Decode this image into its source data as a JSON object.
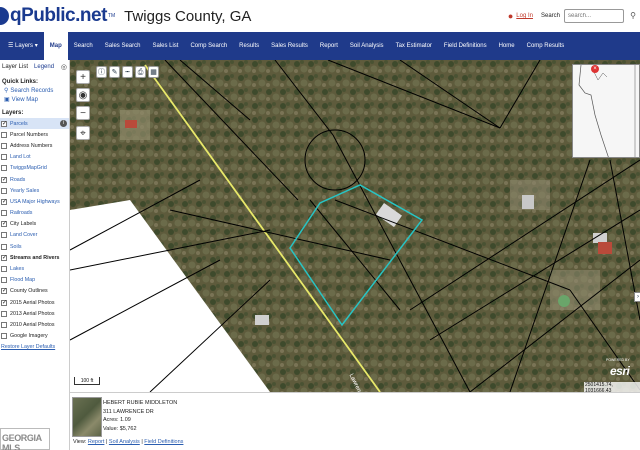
{
  "header": {
    "logo_text": "qPublic.net",
    "logo_tm": "TM",
    "county": "Twiggs County, GA",
    "login": "Log In",
    "search_label": "Search",
    "search_placeholder": "search..."
  },
  "nav": {
    "layers": "Layers",
    "items": [
      "Map",
      "Search",
      "Sales Search",
      "Sales List",
      "Comp Search",
      "Results",
      "Sales Results",
      "Report",
      "Soil Analysis",
      "Tax Estimator",
      "Field Definitions",
      "Home",
      "Comp Results"
    ]
  },
  "sidebar": {
    "tabs": [
      "Layer List",
      "Legend"
    ],
    "quick_links_heading": "Quick Links:",
    "quick_links": [
      "Search Records",
      "View Map"
    ],
    "layers_heading": "Layers:",
    "layers": [
      {
        "label": "Parcels",
        "checked": true,
        "style": "blue"
      },
      {
        "label": "Parcel Numbers",
        "checked": false,
        "style": ""
      },
      {
        "label": "Address Numbers",
        "checked": false,
        "style": ""
      },
      {
        "label": "Land Lot",
        "checked": false,
        "style": "blue"
      },
      {
        "label": "TwiggsMapGrid",
        "checked": false,
        "style": "blue"
      },
      {
        "label": "Roads",
        "checked": true,
        "style": "blue"
      },
      {
        "label": "Yearly Sales",
        "checked": false,
        "style": "blue"
      },
      {
        "label": "USA Major Highways",
        "checked": true,
        "style": "blue"
      },
      {
        "label": "Railroads",
        "checked": false,
        "style": "blue"
      },
      {
        "label": "City Labels",
        "checked": true,
        "style": ""
      },
      {
        "label": "Land Cover",
        "checked": false,
        "style": "blue"
      },
      {
        "label": "Soils",
        "checked": false,
        "style": "blue"
      },
      {
        "label": "Streams and Rivers",
        "checked": true,
        "style": "bold"
      },
      {
        "label": "Lakes",
        "checked": false,
        "style": "blue"
      },
      {
        "label": "Flood Map",
        "checked": false,
        "style": "blue"
      },
      {
        "label": "County Outlines",
        "checked": true,
        "style": ""
      },
      {
        "label": "2015 Aerial Photos",
        "checked": true,
        "style": ""
      },
      {
        "label": "2013 Aerial Photos",
        "checked": false,
        "style": ""
      },
      {
        "label": "2010 Aerial Photos",
        "checked": false,
        "style": ""
      },
      {
        "label": "Google Imagery",
        "checked": false,
        "style": ""
      }
    ],
    "restore": "Restore Layer Defaults"
  },
  "map": {
    "zoom_in": "+",
    "zoom_out": "−",
    "scale": "100 ft",
    "powered_by": "POWERED BY",
    "esri": "esri",
    "coords": "2501415.74, 1031666.43",
    "road_label": "Lawrence Dr",
    "colors": {
      "parcel_line": "#000000",
      "selected_parcel": "#27c4c4",
      "road": "#e8e86a"
    }
  },
  "info_panel": {
    "owner": "HEBERT RUBIE MIDDLETON",
    "address": "311 LAWRENCE DR",
    "acres": "Acres: 1.09",
    "value": "Value: $5,762",
    "view_label": "View:",
    "links": [
      "Report",
      "Soil Analysis",
      "Field Definitions"
    ]
  },
  "watermark": "GEORGIA MLS"
}
